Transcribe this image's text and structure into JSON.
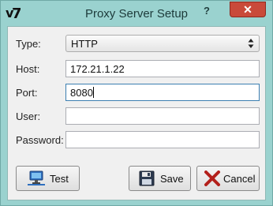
{
  "window": {
    "title": "Proxy Server Setup",
    "help_label": "?",
    "close_label": "✕",
    "app_icon": "v7-logo-icon"
  },
  "form": {
    "type": {
      "label": "Type:",
      "value": "HTTP"
    },
    "host": {
      "label": "Host:",
      "value": "172.21.1.22"
    },
    "port": {
      "label": "Port:",
      "value": "8080"
    },
    "user": {
      "label": "User:",
      "value": ""
    },
    "password": {
      "label": "Password:",
      "value": ""
    }
  },
  "buttons": {
    "test": {
      "label": "Test",
      "icon": "computer-network-icon"
    },
    "save": {
      "label": "Save",
      "icon": "floppy-disk-icon"
    },
    "cancel": {
      "label": "Cancel",
      "icon": "cancel-x-icon"
    }
  },
  "colors": {
    "frame": "#9ad2cf",
    "close": "#c94a3a",
    "focus": "#3c7fb1"
  }
}
